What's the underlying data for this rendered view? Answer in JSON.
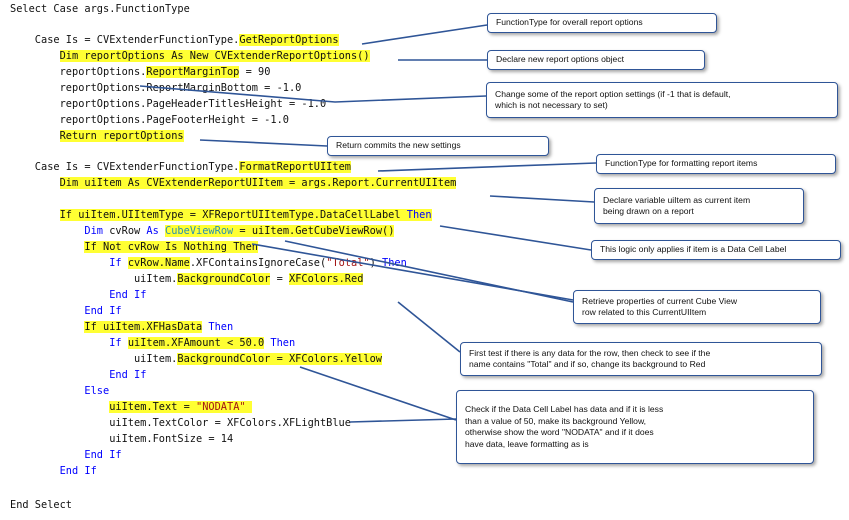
{
  "colors": {
    "highlight": "#ffff33",
    "keyword": "#0000ff",
    "type": "#2b91af",
    "string": "#a31515",
    "text": "#111111",
    "callout_border": "#2f5597"
  },
  "code_lines": [
    {
      "tokens": [
        {
          "t": "Select Case args.FunctionType",
          "c": "text"
        }
      ]
    },
    {
      "tokens": []
    },
    {
      "tokens": [
        {
          "t": "    Case Is = CVExtenderFunctionType.",
          "c": "text"
        },
        {
          "t": "GetReportOptions",
          "c": "text",
          "hl": true
        }
      ]
    },
    {
      "tokens": [
        {
          "t": "        ",
          "c": "text"
        },
        {
          "t": "Dim reportOptions As New CVExtenderReportOptions()",
          "c": "text",
          "hl": true
        }
      ]
    },
    {
      "tokens": [
        {
          "t": "        reportOptions.",
          "c": "text"
        },
        {
          "t": "ReportMarginTop",
          "c": "text",
          "hl": true
        },
        {
          "t": " = 90",
          "c": "text"
        }
      ]
    },
    {
      "tokens": [
        {
          "t": "        reportOptions.ReportMarginBottom = -1.0",
          "c": "text"
        }
      ]
    },
    {
      "tokens": [
        {
          "t": "        reportOptions.PageHeaderTitlesHeight = -1.0",
          "c": "text"
        }
      ]
    },
    {
      "tokens": [
        {
          "t": "        reportOptions.PageFooterHeight = -1.0",
          "c": "text"
        }
      ]
    },
    {
      "tokens": [
        {
          "t": "        ",
          "c": "text"
        },
        {
          "t": "Return reportOptions",
          "c": "text",
          "hl": true
        }
      ]
    },
    {
      "tokens": []
    },
    {
      "tokens": [
        {
          "t": "    Case Is = CVExtenderFunctionType.",
          "c": "text"
        },
        {
          "t": "FormatReportUIItem",
          "c": "text",
          "hl": true
        }
      ]
    },
    {
      "tokens": [
        {
          "t": "        ",
          "c": "text"
        },
        {
          "t": "Dim uiItem As CVExtenderReportUIItem = args.Report.CurrentUIItem",
          "c": "text",
          "hl": true
        }
      ]
    },
    {
      "tokens": []
    },
    {
      "tokens": [
        {
          "t": "        ",
          "c": "text"
        },
        {
          "t": "If uiItem.UIItemType = XFReportUIItemType.DataCellLabel ",
          "c": "text",
          "hl": true
        },
        {
          "t": "Then",
          "c": "keyword",
          "hl": true
        }
      ]
    },
    {
      "tokens": [
        {
          "t": "            ",
          "c": "text"
        },
        {
          "t": "Dim",
          "c": "keyword"
        },
        {
          "t": " cvRow ",
          "c": "text"
        },
        {
          "t": "As",
          "c": "keyword"
        },
        {
          "t": " ",
          "c": "text"
        },
        {
          "t": "CubeViewRow",
          "c": "type",
          "hl": true
        },
        {
          "t": " = uiItem.GetCubeViewRow()",
          "c": "text",
          "hl": true
        }
      ]
    },
    {
      "tokens": [
        {
          "t": "            ",
          "c": "text"
        },
        {
          "t": "If Not cvRow Is Nothing Then",
          "c": "text",
          "hl": true
        }
      ]
    },
    {
      "tokens": [
        {
          "t": "                ",
          "c": "text"
        },
        {
          "t": "If",
          "c": "keyword"
        },
        {
          "t": " ",
          "c": "text"
        },
        {
          "t": "cvRow.Name",
          "c": "text",
          "hl": true
        },
        {
          "t": ".XFContainsIgnoreCase(",
          "c": "text"
        },
        {
          "t": "\"Total\"",
          "c": "string"
        },
        {
          "t": ") ",
          "c": "text"
        },
        {
          "t": "Then",
          "c": "keyword"
        }
      ]
    },
    {
      "tokens": [
        {
          "t": "                    uiItem.",
          "c": "text"
        },
        {
          "t": "BackgroundColor",
          "c": "text",
          "hl": true
        },
        {
          "t": " = ",
          "c": "text"
        },
        {
          "t": "XFColors.Red",
          "c": "text",
          "hl": true
        }
      ]
    },
    {
      "tokens": [
        {
          "t": "                ",
          "c": "text"
        },
        {
          "t": "End If",
          "c": "keyword"
        }
      ]
    },
    {
      "tokens": [
        {
          "t": "            ",
          "c": "text"
        },
        {
          "t": "End If",
          "c": "keyword"
        }
      ]
    },
    {
      "tokens": [
        {
          "t": "            ",
          "c": "text"
        },
        {
          "t": "If uiItem.XFHasData",
          "c": "text",
          "hl": true
        },
        {
          "t": " ",
          "c": "text"
        },
        {
          "t": "Then",
          "c": "keyword"
        }
      ]
    },
    {
      "tokens": [
        {
          "t": "                ",
          "c": "text"
        },
        {
          "t": "If",
          "c": "keyword"
        },
        {
          "t": " ",
          "c": "text"
        },
        {
          "t": "uiItem.XFAmount < 50.0",
          "c": "text",
          "hl": true
        },
        {
          "t": " ",
          "c": "text"
        },
        {
          "t": "Then",
          "c": "keyword"
        }
      ]
    },
    {
      "tokens": [
        {
          "t": "                    uiItem.",
          "c": "text"
        },
        {
          "t": "BackgroundColor = XFColors.Yellow",
          "c": "text",
          "hl": true
        }
      ]
    },
    {
      "tokens": [
        {
          "t": "                ",
          "c": "text"
        },
        {
          "t": "End If",
          "c": "keyword"
        }
      ]
    },
    {
      "tokens": [
        {
          "t": "            ",
          "c": "text"
        },
        {
          "t": "Else",
          "c": "keyword"
        }
      ]
    },
    {
      "tokens": [
        {
          "t": "                ",
          "c": "text"
        },
        {
          "t": "uiItem.Text = ",
          "c": "text",
          "hl": true
        },
        {
          "t": "\"NODATA\"",
          "c": "string",
          "hl": true
        },
        {
          "t": " ",
          "c": "text",
          "hl": true
        }
      ]
    },
    {
      "tokens": [
        {
          "t": "                uiItem.TextColor = XFColors.XFLightBlue",
          "c": "text"
        }
      ]
    },
    {
      "tokens": [
        {
          "t": "                uiItem.FontSize = 14",
          "c": "text"
        }
      ]
    },
    {
      "tokens": [
        {
          "t": "            ",
          "c": "text"
        },
        {
          "t": "End If",
          "c": "keyword"
        }
      ]
    },
    {
      "tokens": [
        {
          "t": "        ",
          "c": "text"
        },
        {
          "t": "End If",
          "c": "keyword"
        }
      ]
    },
    {
      "tokens": []
    },
    {
      "tokens": []
    },
    {
      "tokens": [
        {
          "t": "End Select",
          "c": "text"
        }
      ]
    }
  ],
  "callouts": [
    {
      "id": "function-type-overall-callout",
      "lines": [
        "FunctionType for overall report options"
      ]
    },
    {
      "id": "declare-report-options-callout",
      "lines": [
        "Declare new report options object"
      ]
    },
    {
      "id": "change-report-settings-callout",
      "lines": [
        "Change some of the report option settings (if -1 that is default,",
        "which is not necessary to set)"
      ]
    },
    {
      "id": "return-commits-callout",
      "lines": [
        "Return commits the new settings"
      ]
    },
    {
      "id": "function-type-formatting-callout",
      "lines": [
        "FunctionType for formatting report items"
      ]
    },
    {
      "id": "declare-uiitem-callout",
      "lines": [
        "Declare variable uiItem as current item",
        "being drawn on a report"
      ]
    },
    {
      "id": "data-cell-label-logic-callout",
      "lines": [
        "This logic only applies if item is a Data Cell Label"
      ]
    },
    {
      "id": "retrieve-cube-view-row-callout",
      "lines": [
        "Retrieve properties of current Cube View",
        "row related to this CurrentUIItem"
      ]
    },
    {
      "id": "first-test-data-callout",
      "lines": [
        "First test if there is any data for the row, then check to see if the",
        "name contains \"Total\" and if so, change its background to Red"
      ]
    },
    {
      "id": "check-data-cell-label-callout",
      "lines": [
        "Check if the Data Cell Label has data and if it is less",
        "than a value of 50, make its background Yellow,",
        "otherwise show the word \"NODATA\" and if it does",
        "have data, leave formatting as is"
      ]
    }
  ]
}
